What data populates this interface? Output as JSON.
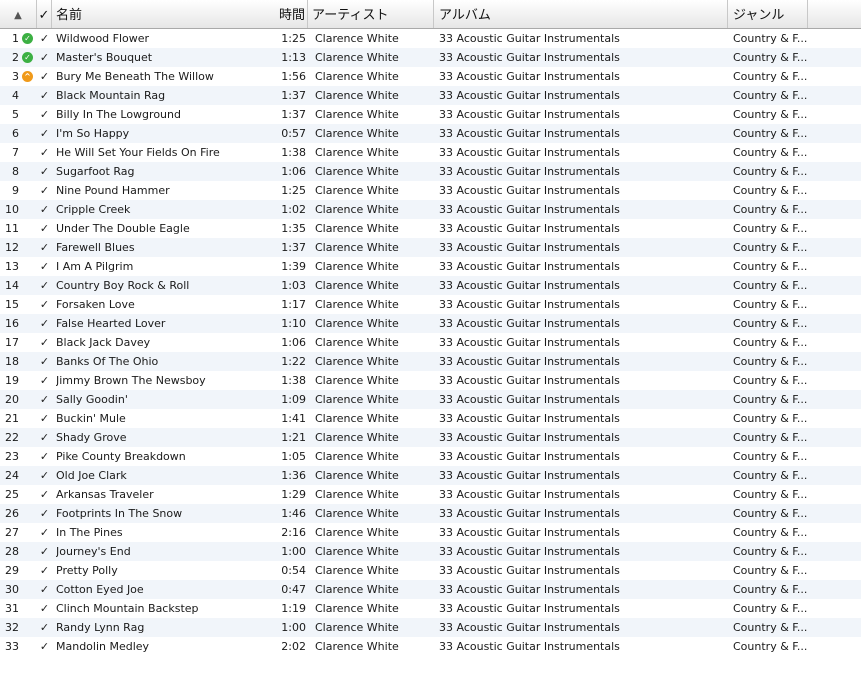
{
  "header": {
    "sort_arrow": "▲",
    "check_label": "✓",
    "name_label": "名前",
    "time_label": "時間",
    "artist_label": "アーティスト",
    "album_label": "アルバム",
    "genre_label": "ジャンル"
  },
  "colors": {
    "status_ok": "#3cb043",
    "status_warn": "#f09a1a",
    "stripe": "#f1f5fa"
  },
  "tracks": [
    {
      "num": "1",
      "status": "ok",
      "check": "✓",
      "name": "Wildwood Flower",
      "time": "1:25",
      "artist": "Clarence White",
      "album": "33 Acoustic Guitar Instrumentals",
      "genre": "Country & F..."
    },
    {
      "num": "2",
      "status": "ok",
      "check": "✓",
      "name": "Master's Bouquet",
      "time": "1:13",
      "artist": "Clarence White",
      "album": "33 Acoustic Guitar Instrumentals",
      "genre": "Country & F..."
    },
    {
      "num": "3",
      "status": "warn",
      "check": "✓",
      "name": "Bury Me Beneath The Willow",
      "time": "1:56",
      "artist": "Clarence White",
      "album": "33 Acoustic Guitar Instrumentals",
      "genre": "Country & F..."
    },
    {
      "num": "4",
      "status": "",
      "check": "✓",
      "name": "Black Mountain Rag",
      "time": "1:37",
      "artist": "Clarence White",
      "album": "33 Acoustic Guitar Instrumentals",
      "genre": "Country & F..."
    },
    {
      "num": "5",
      "status": "",
      "check": "✓",
      "name": "Billy In The Lowground",
      "time": "1:37",
      "artist": "Clarence White",
      "album": "33 Acoustic Guitar Instrumentals",
      "genre": "Country & F..."
    },
    {
      "num": "6",
      "status": "",
      "check": "✓",
      "name": "I'm So Happy",
      "time": "0:57",
      "artist": "Clarence White",
      "album": "33 Acoustic Guitar Instrumentals",
      "genre": "Country & F..."
    },
    {
      "num": "7",
      "status": "",
      "check": "✓",
      "name": "He Will Set Your Fields On Fire",
      "time": "1:38",
      "artist": "Clarence White",
      "album": "33 Acoustic Guitar Instrumentals",
      "genre": "Country & F..."
    },
    {
      "num": "8",
      "status": "",
      "check": "✓",
      "name": "Sugarfoot Rag",
      "time": "1:06",
      "artist": "Clarence White",
      "album": "33 Acoustic Guitar Instrumentals",
      "genre": "Country & F..."
    },
    {
      "num": "9",
      "status": "",
      "check": "✓",
      "name": "Nine Pound Hammer",
      "time": "1:25",
      "artist": "Clarence White",
      "album": "33 Acoustic Guitar Instrumentals",
      "genre": "Country & F..."
    },
    {
      "num": "10",
      "status": "",
      "check": "✓",
      "name": "Cripple Creek",
      "time": "1:02",
      "artist": "Clarence White",
      "album": "33 Acoustic Guitar Instrumentals",
      "genre": "Country & F..."
    },
    {
      "num": "11",
      "status": "",
      "check": "✓",
      "name": "Under The Double Eagle",
      "time": "1:35",
      "artist": "Clarence White",
      "album": "33 Acoustic Guitar Instrumentals",
      "genre": "Country & F..."
    },
    {
      "num": "12",
      "status": "",
      "check": "✓",
      "name": "Farewell Blues",
      "time": "1:37",
      "artist": "Clarence White",
      "album": "33 Acoustic Guitar Instrumentals",
      "genre": "Country & F..."
    },
    {
      "num": "13",
      "status": "",
      "check": "✓",
      "name": "I Am A Pilgrim",
      "time": "1:39",
      "artist": "Clarence White",
      "album": "33 Acoustic Guitar Instrumentals",
      "genre": "Country & F..."
    },
    {
      "num": "14",
      "status": "",
      "check": "✓",
      "name": "Country Boy Rock & Roll",
      "time": "1:03",
      "artist": "Clarence White",
      "album": "33 Acoustic Guitar Instrumentals",
      "genre": "Country & F..."
    },
    {
      "num": "15",
      "status": "",
      "check": "✓",
      "name": "Forsaken Love",
      "time": "1:17",
      "artist": "Clarence White",
      "album": "33 Acoustic Guitar Instrumentals",
      "genre": "Country & F..."
    },
    {
      "num": "16",
      "status": "",
      "check": "✓",
      "name": "False Hearted Lover",
      "time": "1:10",
      "artist": "Clarence White",
      "album": "33 Acoustic Guitar Instrumentals",
      "genre": "Country & F..."
    },
    {
      "num": "17",
      "status": "",
      "check": "✓",
      "name": "Black Jack Davey",
      "time": "1:06",
      "artist": "Clarence White",
      "album": "33 Acoustic Guitar Instrumentals",
      "genre": "Country & F..."
    },
    {
      "num": "18",
      "status": "",
      "check": "✓",
      "name": "Banks Of The Ohio",
      "time": "1:22",
      "artist": "Clarence White",
      "album": "33 Acoustic Guitar Instrumentals",
      "genre": "Country & F..."
    },
    {
      "num": "19",
      "status": "",
      "check": "✓",
      "name": "Jimmy Brown The Newsboy",
      "time": "1:38",
      "artist": "Clarence White",
      "album": "33 Acoustic Guitar Instrumentals",
      "genre": "Country & F..."
    },
    {
      "num": "20",
      "status": "",
      "check": "✓",
      "name": "Sally Goodin'",
      "time": "1:09",
      "artist": "Clarence White",
      "album": "33 Acoustic Guitar Instrumentals",
      "genre": "Country & F..."
    },
    {
      "num": "21",
      "status": "",
      "check": "✓",
      "name": "Buckin' Mule",
      "time": "1:41",
      "artist": "Clarence White",
      "album": "33 Acoustic Guitar Instrumentals",
      "genre": "Country & F..."
    },
    {
      "num": "22",
      "status": "",
      "check": "✓",
      "name": "Shady Grove",
      "time": "1:21",
      "artist": "Clarence White",
      "album": "33 Acoustic Guitar Instrumentals",
      "genre": "Country & F..."
    },
    {
      "num": "23",
      "status": "",
      "check": "✓",
      "name": "Pike County Breakdown",
      "time": "1:05",
      "artist": "Clarence White",
      "album": "33 Acoustic Guitar Instrumentals",
      "genre": "Country & F..."
    },
    {
      "num": "24",
      "status": "",
      "check": "✓",
      "name": "Old Joe Clark",
      "time": "1:36",
      "artist": "Clarence White",
      "album": "33 Acoustic Guitar Instrumentals",
      "genre": "Country & F..."
    },
    {
      "num": "25",
      "status": "",
      "check": "✓",
      "name": "Arkansas Traveler",
      "time": "1:29",
      "artist": "Clarence White",
      "album": "33 Acoustic Guitar Instrumentals",
      "genre": "Country & F..."
    },
    {
      "num": "26",
      "status": "",
      "check": "✓",
      "name": "Footprints In The Snow",
      "time": "1:46",
      "artist": "Clarence White",
      "album": "33 Acoustic Guitar Instrumentals",
      "genre": "Country & F..."
    },
    {
      "num": "27",
      "status": "",
      "check": "✓",
      "name": "In The Pines",
      "time": "2:16",
      "artist": "Clarence White",
      "album": "33 Acoustic Guitar Instrumentals",
      "genre": "Country & F..."
    },
    {
      "num": "28",
      "status": "",
      "check": "✓",
      "name": "Journey's End",
      "time": "1:00",
      "artist": "Clarence White",
      "album": "33 Acoustic Guitar Instrumentals",
      "genre": "Country & F..."
    },
    {
      "num": "29",
      "status": "",
      "check": "✓",
      "name": "Pretty Polly",
      "time": "0:54",
      "artist": "Clarence White",
      "album": "33 Acoustic Guitar Instrumentals",
      "genre": "Country & F..."
    },
    {
      "num": "30",
      "status": "",
      "check": "✓",
      "name": "Cotton Eyed Joe",
      "time": "0:47",
      "artist": "Clarence White",
      "album": "33 Acoustic Guitar Instrumentals",
      "genre": "Country & F..."
    },
    {
      "num": "31",
      "status": "",
      "check": "✓",
      "name": "Clinch Mountain Backstep",
      "time": "1:19",
      "artist": "Clarence White",
      "album": "33 Acoustic Guitar Instrumentals",
      "genre": "Country & F..."
    },
    {
      "num": "32",
      "status": "",
      "check": "✓",
      "name": "Randy Lynn Rag",
      "time": "1:00",
      "artist": "Clarence White",
      "album": "33 Acoustic Guitar Instrumentals",
      "genre": "Country & F..."
    },
    {
      "num": "33",
      "status": "",
      "check": "✓",
      "name": "Mandolin Medley",
      "time": "2:02",
      "artist": "Clarence White",
      "album": "33 Acoustic Guitar Instrumentals",
      "genre": "Country & F..."
    }
  ]
}
